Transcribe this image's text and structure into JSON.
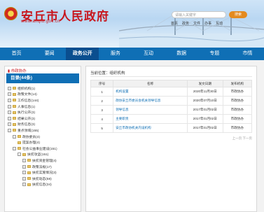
{
  "header": {
    "title": "安丘市人民政府",
    "url": "www.anqiu.gov.cn",
    "search_placeholder": "请输入关键字",
    "search_button": "搜索",
    "top_links": [
      "首页",
      "政务",
      "文件",
      "办事",
      "互动"
    ]
  },
  "nav": [
    "首页",
    "要闻",
    "政务公开",
    "服务",
    "互动",
    "数据",
    "专题",
    "市情"
  ],
  "nav_active_index": 2,
  "sidebar": {
    "top_label": "市政协办",
    "title": "目录(44条)",
    "tree": [
      {
        "label": "组织机构(1)",
        "level": 0,
        "exp": "+"
      },
      {
        "label": "政策文件(14)",
        "level": 0,
        "exp": "+"
      },
      {
        "label": "工作信息(144)",
        "level": 0,
        "exp": "+"
      },
      {
        "label": "人事信息(1)",
        "level": 0,
        "exp": "+"
      },
      {
        "label": "执行公开(3)",
        "level": 0,
        "exp": "+"
      },
      {
        "label": "结果公开(3)",
        "level": 0,
        "exp": "+"
      },
      {
        "label": "财务信息(3)",
        "level": 0,
        "exp": "+"
      },
      {
        "label": "重点领域(155)",
        "level": 0,
        "exp": "-"
      },
      {
        "label": "政协委员(4)",
        "level": 1,
        "exp": "-"
      },
      {
        "label": "提案办理(4)",
        "level": 2,
        "exp": ""
      },
      {
        "label": "社会公益事业建设(151)",
        "level": 1,
        "exp": "-"
      },
      {
        "label": "扶贫攻坚(151)",
        "level": 2,
        "exp": "-"
      },
      {
        "label": "扶贫资金管理(4)",
        "level": 3,
        "exp": "+"
      },
      {
        "label": "政策法规(17)",
        "level": 3,
        "exp": "+"
      },
      {
        "label": "扶贫实施情况(3)",
        "level": 3,
        "exp": "+"
      },
      {
        "label": "扶贫动态(58)",
        "level": 3,
        "exp": "+"
      },
      {
        "label": "扶贫信息(34)",
        "level": 3,
        "exp": "+"
      }
    ]
  },
  "main": {
    "breadcrumb": "当前位置：组织机构",
    "columns": [
      "序号",
      "名称",
      "发文日期",
      "发布机构"
    ],
    "rows": [
      {
        "no": "1",
        "name": "机构设置",
        "date": "2020年11月30日",
        "org": "市政协办"
      },
      {
        "no": "2",
        "name": "政协安丘市委员会机关领导信息",
        "date": "2020年07月10日",
        "org": "市政协办"
      },
      {
        "no": "3",
        "name": "领导信息",
        "date": "2017年01月02日",
        "org": "市政协办"
      },
      {
        "no": "4",
        "name": "主要职责",
        "date": "2017年01月02日",
        "org": "市政协办"
      },
      {
        "no": "5",
        "name": "安丘市政协机关内设机构",
        "date": "2017年01月02日",
        "org": "市政协办"
      }
    ],
    "pager": "上一页 下一页"
  }
}
